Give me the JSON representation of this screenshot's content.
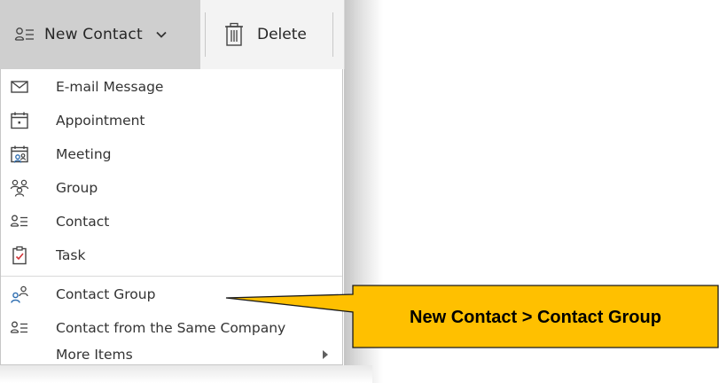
{
  "toolbar": {
    "new_contact_label": "New Contact",
    "new_contact_icon": "contact-card-icon",
    "dropdown_icon": "chevron-down-icon",
    "delete_label": "Delete",
    "delete_icon": "trash-icon"
  },
  "menu": {
    "items": [
      {
        "label": "E-mail Message",
        "icon": "envelope-icon"
      },
      {
        "label": "Appointment",
        "icon": "calendar-icon"
      },
      {
        "label": "Meeting",
        "icon": "meeting-calendar-icon"
      },
      {
        "label": "Group",
        "icon": "group-people-icon"
      },
      {
        "label": "Contact",
        "icon": "contact-card-icon"
      },
      {
        "label": "Task",
        "icon": "task-clipboard-icon"
      },
      {
        "label": "Contact Group",
        "icon": "contact-group-icon"
      },
      {
        "label": "Contact from the Same Company",
        "icon": "contact-card-icon"
      },
      {
        "label": "More Items",
        "icon": "submenu-arrow-icon"
      }
    ]
  },
  "callout": {
    "text": "New Contact > Contact Group",
    "fill_color": "#FFC000",
    "border_color": "#1a1a1a"
  },
  "colors": {
    "menu_text": "#333333",
    "accent_blue": "#2b6cb0",
    "task_check_red": "#d13438",
    "toolbar_pressed": "#cfcfcf"
  }
}
